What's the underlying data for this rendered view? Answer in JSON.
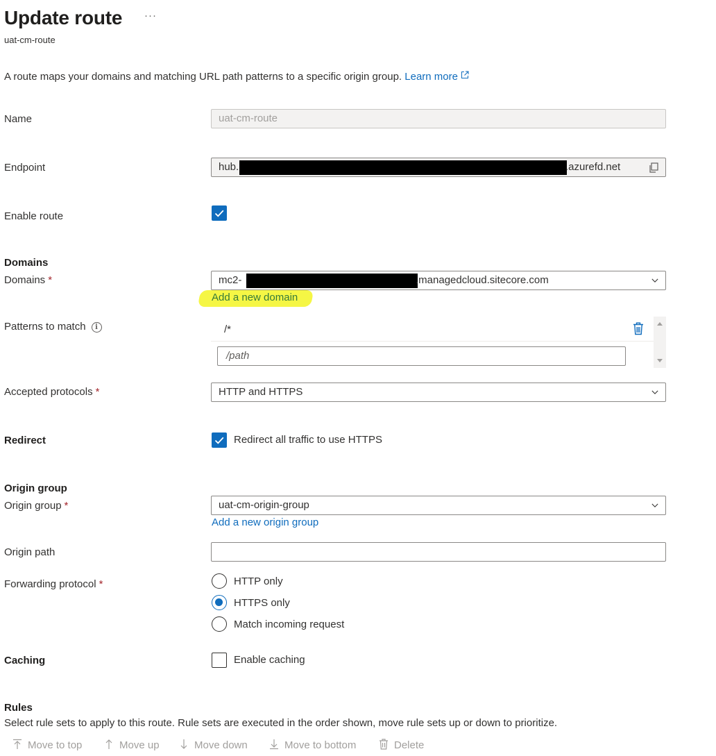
{
  "header": {
    "title": "Update route",
    "more_label": "···",
    "subtitle": "uat-cm-route"
  },
  "description": {
    "text": "A route maps your domains and matching URL path patterns to a specific origin group. ",
    "learn_more": "Learn more"
  },
  "fields": {
    "name": {
      "label": "Name",
      "value": "uat-cm-route"
    },
    "endpoint": {
      "label": "Endpoint",
      "value_prefix": "hub.",
      "value_suffix": ".azurefd.net"
    },
    "enable_route": {
      "label": "Enable route",
      "checked": true
    },
    "domains_section": "Domains",
    "domains": {
      "label": "Domains",
      "required_mark": "*",
      "value_prefix": "mc2-",
      "value_suffix": ".managedcloud.sitecore.com",
      "add_link": "Add a new domain"
    },
    "patterns": {
      "label": "Patterns to match",
      "info_icon": "i",
      "items": [
        "/*"
      ],
      "placeholder": "/path"
    },
    "accepted_protocols": {
      "label": "Accepted protocols",
      "required_mark": "*",
      "value": "HTTP and HTTPS"
    },
    "redirect": {
      "label": "Redirect",
      "checkbox_label": "Redirect all traffic to use HTTPS",
      "checked": true
    },
    "origin_section": "Origin group",
    "origin_group": {
      "label": "Origin group",
      "required_mark": "*",
      "value": "uat-cm-origin-group",
      "add_link": "Add a new origin group"
    },
    "origin_path": {
      "label": "Origin path",
      "value": ""
    },
    "forwarding_protocol": {
      "label": "Forwarding protocol",
      "required_mark": "*",
      "options": [
        "HTTP only",
        "HTTPS only",
        "Match incoming request"
      ],
      "selected": "HTTPS only"
    },
    "caching": {
      "label": "Caching",
      "checkbox_label": "Enable caching",
      "checked": false
    }
  },
  "rules": {
    "title": "Rules",
    "description": "Select rule sets to apply to this route. Rule sets are executed in the order shown, move rule sets up or down to prioritize.",
    "toolbar": {
      "move_to_top": "Move to top",
      "move_up": "Move up",
      "move_down": "Move down",
      "move_to_bottom": "Move to bottom",
      "delete": "Delete"
    }
  },
  "colors": {
    "accent": "#0f6cbd",
    "highlight": "#f4f53b",
    "required": "#a4262c"
  },
  "icons": [
    "more-icon",
    "external-link-icon",
    "copy-icon",
    "chevron-down-icon",
    "info-icon",
    "trash-icon",
    "checkmark-icon",
    "arrow-up-icon",
    "arrow-down-icon",
    "move-to-top-icon",
    "move-to-bottom-icon",
    "delete-icon"
  ]
}
